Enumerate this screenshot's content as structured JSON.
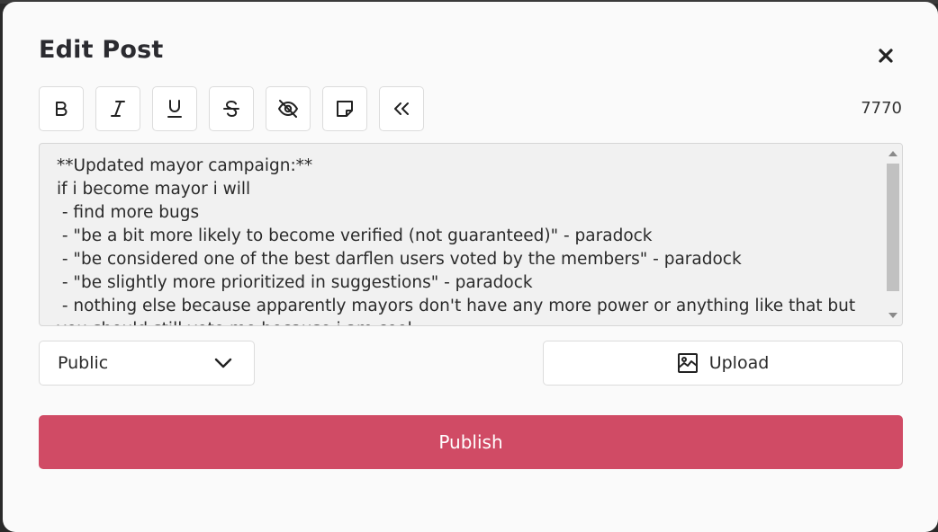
{
  "modal": {
    "title": "Edit Post",
    "character_count": "7770"
  },
  "toolbar": {
    "buttons": [
      {
        "name": "bold",
        "icon": "bold-icon"
      },
      {
        "name": "italic",
        "icon": "italic-icon"
      },
      {
        "name": "underline",
        "icon": "underline-icon"
      },
      {
        "name": "strikethrough",
        "icon": "strikethrough-icon"
      },
      {
        "name": "spoiler",
        "icon": "eye-slash-icon"
      },
      {
        "name": "note",
        "icon": "sticky-note-icon"
      },
      {
        "name": "quote",
        "icon": "double-chevron-left-icon"
      }
    ]
  },
  "editor": {
    "lines": [
      "**Updated mayor campaign:**",
      "if i become mayor i will",
      " - find more bugs",
      " - \"be a bit more likely to become verified (not guaranteed)\" - paradock",
      " - \"be considered one of the best darflen users voted by the members\" - paradock",
      " - \"be slightly more prioritized in suggestions\" - paradock",
      " - nothing else because apparently mayors don't have any more power or anything like that but",
      "you should still vote me because i am cool"
    ]
  },
  "visibility": {
    "selected": "Public"
  },
  "upload": {
    "label": "Upload"
  },
  "publish": {
    "label": "Publish"
  },
  "colors": {
    "accent": "#d04b65",
    "modal_bg": "#fafafa",
    "editor_bg": "#f1f1f1"
  }
}
